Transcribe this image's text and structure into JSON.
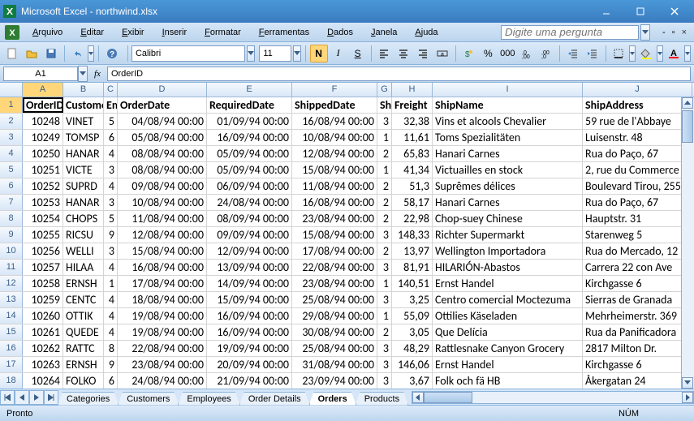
{
  "title": "Microsoft Excel - northwind.xlsx",
  "menu": [
    "Arquivo",
    "Editar",
    "Exibir",
    "Inserir",
    "Formatar",
    "Ferramentas",
    "Dados",
    "Janela",
    "Ajuda"
  ],
  "askbox_placeholder": "Digite uma pergunta",
  "font": "Calibri",
  "fontsize": "11",
  "namebox": "A1",
  "formula": "OrderID",
  "cols": [
    {
      "letter": "A",
      "w": 50
    },
    {
      "letter": "B",
      "w": 50
    },
    {
      "letter": "C",
      "w": 17
    },
    {
      "letter": "D",
      "w": 110
    },
    {
      "letter": "E",
      "w": 105
    },
    {
      "letter": "F",
      "w": 105
    },
    {
      "letter": "G",
      "w": 18
    },
    {
      "letter": "H",
      "w": 50
    },
    {
      "letter": "I",
      "w": 185
    },
    {
      "letter": "J",
      "w": 135
    }
  ],
  "header_row": [
    "OrderID",
    "CustomerID",
    "EmployeeID",
    "OrderDate",
    "RequiredDate",
    "ShippedDate",
    "ShipVia",
    "Freight",
    "ShipName",
    "ShipAddress"
  ],
  "rows": [
    [
      "10248",
      "VINET",
      "5",
      "04/08/94 00:00",
      "01/09/94 00:00",
      "16/08/94 00:00",
      "3",
      "32,38",
      "Vins et alcools Chevalier",
      "59 rue de l'Abbaye"
    ],
    [
      "10249",
      "TOMSP",
      "6",
      "05/08/94 00:00",
      "16/09/94 00:00",
      "10/08/94 00:00",
      "1",
      "11,61",
      "Toms Spezialitäten",
      "Luisenstr. 48"
    ],
    [
      "10250",
      "HANAR",
      "4",
      "08/08/94 00:00",
      "05/09/94 00:00",
      "12/08/94 00:00",
      "2",
      "65,83",
      "Hanari Carnes",
      "Rua do Paço, 67"
    ],
    [
      "10251",
      "VICTE",
      "3",
      "08/08/94 00:00",
      "05/09/94 00:00",
      "15/08/94 00:00",
      "1",
      "41,34",
      "Victuailles en stock",
      "2, rue du Commerce"
    ],
    [
      "10252",
      "SUPRD",
      "4",
      "09/08/94 00:00",
      "06/09/94 00:00",
      "11/08/94 00:00",
      "2",
      "51,3",
      "Suprêmes délices",
      "Boulevard Tirou, 255"
    ],
    [
      "10253",
      "HANAR",
      "3",
      "10/08/94 00:00",
      "24/08/94 00:00",
      "16/08/94 00:00",
      "2",
      "58,17",
      "Hanari Carnes",
      "Rua do Paço, 67"
    ],
    [
      "10254",
      "CHOPS",
      "5",
      "11/08/94 00:00",
      "08/09/94 00:00",
      "23/08/94 00:00",
      "2",
      "22,98",
      "Chop-suey Chinese",
      "Hauptstr. 31"
    ],
    [
      "10255",
      "RICSU",
      "9",
      "12/08/94 00:00",
      "09/09/94 00:00",
      "15/08/94 00:00",
      "3",
      "148,33",
      "Richter Supermarkt",
      "Starenweg 5"
    ],
    [
      "10256",
      "WELLI",
      "3",
      "15/08/94 00:00",
      "12/09/94 00:00",
      "17/08/94 00:00",
      "2",
      "13,97",
      "Wellington Importadora",
      "Rua do Mercado, 12"
    ],
    [
      "10257",
      "HILAA",
      "4",
      "16/08/94 00:00",
      "13/09/94 00:00",
      "22/08/94 00:00",
      "3",
      "81,91",
      "HILARIÓN-Abastos",
      "Carrera 22 con Ave"
    ],
    [
      "10258",
      "ERNSH",
      "1",
      "17/08/94 00:00",
      "14/09/94 00:00",
      "23/08/94 00:00",
      "1",
      "140,51",
      "Ernst Handel",
      "Kirchgasse 6"
    ],
    [
      "10259",
      "CENTC",
      "4",
      "18/08/94 00:00",
      "15/09/94 00:00",
      "25/08/94 00:00",
      "3",
      "3,25",
      "Centro comercial Moctezuma",
      "Sierras de Granada"
    ],
    [
      "10260",
      "OTTIK",
      "4",
      "19/08/94 00:00",
      "16/09/94 00:00",
      "29/08/94 00:00",
      "1",
      "55,09",
      "Ottilies Käseladen",
      "Mehrheimerstr. 369"
    ],
    [
      "10261",
      "QUEDE",
      "4",
      "19/08/94 00:00",
      "16/09/94 00:00",
      "30/08/94 00:00",
      "2",
      "3,05",
      "Que Delícia",
      "Rua da Panificadora"
    ],
    [
      "10262",
      "RATTC",
      "8",
      "22/08/94 00:00",
      "19/09/94 00:00",
      "25/08/94 00:00",
      "3",
      "48,29",
      "Rattlesnake Canyon Grocery",
      "2817 Milton Dr."
    ],
    [
      "10263",
      "ERNSH",
      "9",
      "23/08/94 00:00",
      "20/09/94 00:00",
      "31/08/94 00:00",
      "3",
      "146,06",
      "Ernst Handel",
      "Kirchgasse 6"
    ],
    [
      "10264",
      "FOLKO",
      "6",
      "24/08/94 00:00",
      "21/09/94 00:00",
      "23/09/94 00:00",
      "3",
      "3,67",
      "Folk och fä HB",
      "Åkergatan 24"
    ]
  ],
  "tabs": [
    "Categories",
    "Customers",
    "Employees",
    "Order Details",
    "Orders",
    "Products"
  ],
  "active_tab": 4,
  "status": "Pronto",
  "status_right": "NÚM",
  "right_align_cols": [
    0,
    2,
    3,
    4,
    5,
    6,
    7
  ]
}
